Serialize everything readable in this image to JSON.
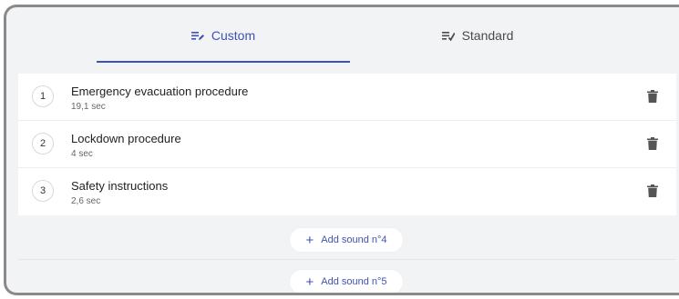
{
  "tabs": [
    {
      "label": "Custom",
      "icon": "playlist-edit-icon",
      "active": true
    },
    {
      "label": "Standard",
      "icon": "playlist-check-icon",
      "active": false
    }
  ],
  "colors": {
    "accent": "#3f51b5",
    "background": "#f2f3f5",
    "row": "#ffffff",
    "delete_icon": "#555555"
  },
  "sounds": [
    {
      "number": "1",
      "title": "Emergency evacuation procedure",
      "duration": "19,1 sec"
    },
    {
      "number": "2",
      "title": "Lockdown procedure",
      "duration": "4 sec"
    },
    {
      "number": "3",
      "title": "Safety instructions",
      "duration": "2,6 sec"
    }
  ],
  "add_buttons": [
    {
      "icon": "plus-icon",
      "symbol": "+",
      "label": "Add sound n°4"
    },
    {
      "icon": "plus-icon",
      "symbol": "+",
      "label": "Add sound n°5"
    }
  ],
  "icons": {
    "delete": "trash-icon"
  }
}
